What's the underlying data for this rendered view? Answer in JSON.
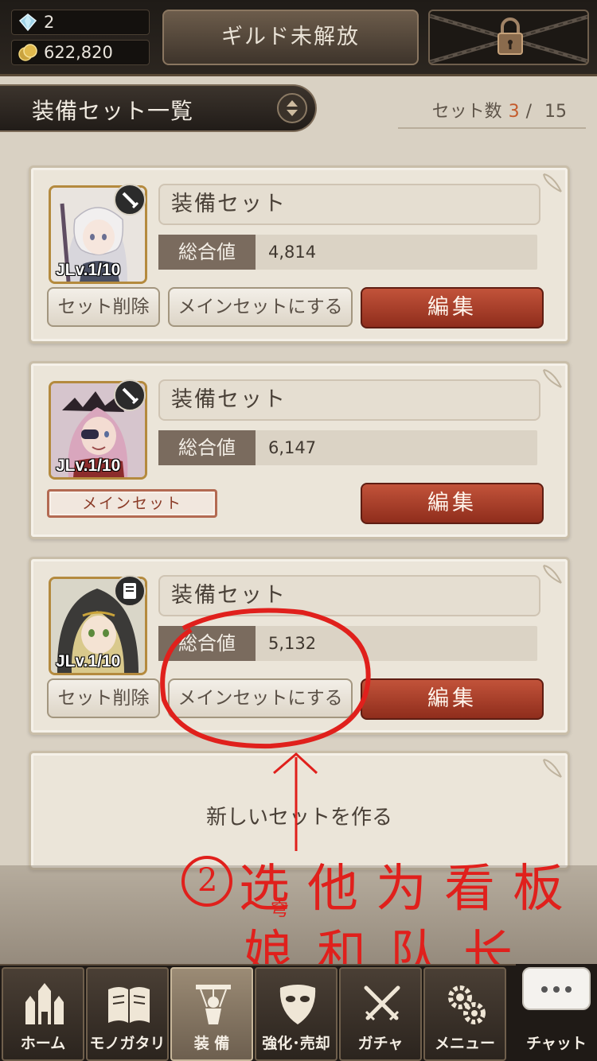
{
  "header": {
    "gems": "2",
    "coins": "622,820",
    "guild_button": "ギルド未解放",
    "locked_icon": "lock-chains-icon"
  },
  "title": {
    "label": "装備セット一覧",
    "set_count_label": "セット数",
    "set_count_current": "3",
    "set_count_separator": "/",
    "set_count_max": "15"
  },
  "sets": [
    {
      "name": "装備セット",
      "total_label": "総合値",
      "total_value": "4,814",
      "level": "JLv.1/10",
      "delete_label": "セット削除",
      "make_main_label": "メインセットにする",
      "edit_label": "編集"
    },
    {
      "name": "装備セット",
      "total_label": "総合値",
      "total_value": "6,147",
      "level": "JLv.1/10",
      "main_badge": "メインセット",
      "edit_label": "編集"
    },
    {
      "name": "装備セット",
      "total_label": "総合値",
      "total_value": "5,132",
      "level": "JLv.1/10",
      "delete_label": "セット削除",
      "make_main_label": "メインセットにする",
      "edit_label": "編集"
    }
  ],
  "new_set_label": "新しいセットを作る",
  "annotation": {
    "circle_number": "2",
    "line1": "选他为看板",
    "line2": "娘和队长",
    "small_mark": "穹"
  },
  "nav": [
    {
      "label": "ホーム",
      "icon": "castle-icon"
    },
    {
      "label": "モノガタリ",
      "icon": "book-icon"
    },
    {
      "label": "装 備",
      "icon": "puppet-icon"
    },
    {
      "label": "強化･売却",
      "icon": "mask-icon"
    },
    {
      "label": "ガチャ",
      "icon": "crossed-swords-icon"
    },
    {
      "label": "メニュー",
      "icon": "gears-icon"
    },
    {
      "label": "チャット",
      "icon": "chat-bubble-icon"
    }
  ],
  "colors": {
    "accent_red": "#c45a2b",
    "edit_button": "#a83c28",
    "annotation_red": "#e0201c"
  }
}
